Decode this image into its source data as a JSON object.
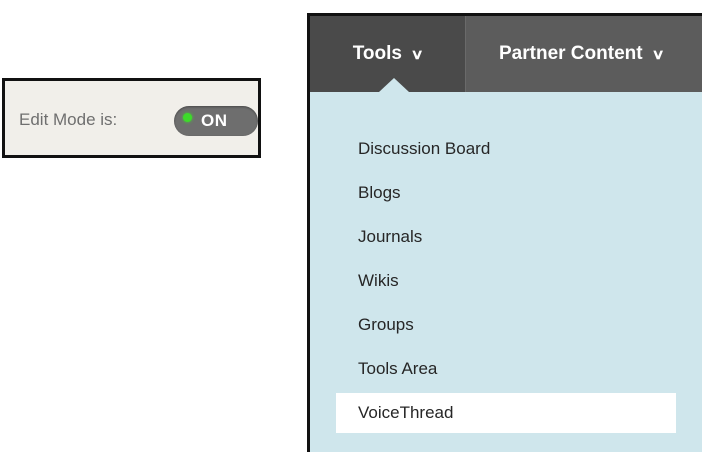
{
  "edit_mode": {
    "label": "Edit Mode is:",
    "state": "ON",
    "indicator_color": "#3ddb2a"
  },
  "nav": {
    "tabs": [
      {
        "label": "Tools",
        "icon": "chevron-down-icon",
        "active": true
      },
      {
        "label": "Partner Content",
        "icon": "chevron-down-icon",
        "active": false
      }
    ]
  },
  "tools_menu": {
    "items": [
      {
        "label": "Discussion Board"
      },
      {
        "label": "Blogs"
      },
      {
        "label": "Journals"
      },
      {
        "label": "Wikis"
      },
      {
        "label": "Groups"
      },
      {
        "label": "Tools Area"
      },
      {
        "label": "VoiceThread",
        "selected": true
      }
    ],
    "background_color": "#cfe6ec",
    "nav_color": "#5c5c5c"
  }
}
